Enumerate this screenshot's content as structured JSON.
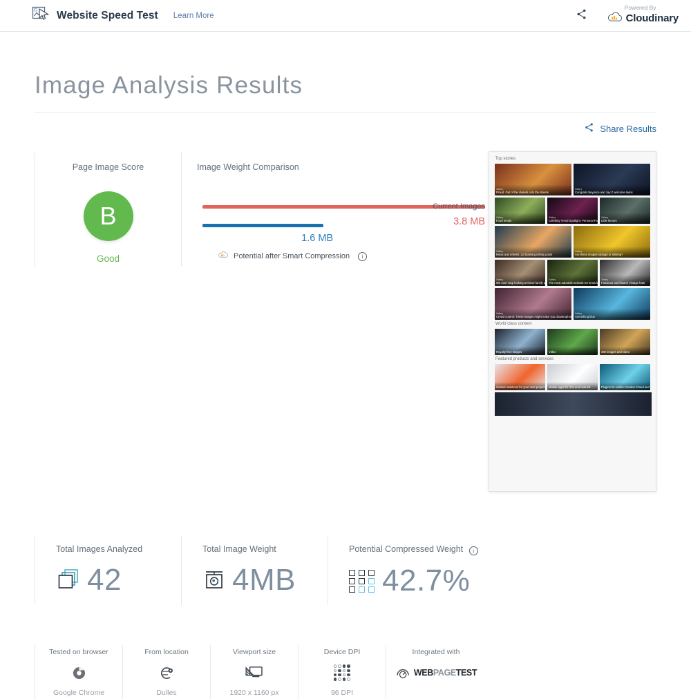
{
  "header": {
    "logo_icon": "image-cursor-icon",
    "title": "Website Speed Test",
    "learn_more": "Learn More",
    "share_icon": "share-icon",
    "powered_by": "Powered By",
    "brand": "Cloudinary"
  },
  "page": {
    "title": "Image Analysis Results",
    "share_results": "Share Results",
    "share_icon": "share-icon"
  },
  "score_card": {
    "label": "Page Image Score",
    "grade": "B",
    "rating": "Good",
    "color": "#62b94d"
  },
  "weight_card": {
    "label": "Image Weight Comparison",
    "current_name": "Current Images",
    "current_value": "3.8 MB",
    "current_color": "#e0645c",
    "potential_value": "1.6 MB",
    "potential_color": "#2c7fbd",
    "potential_label": "Potential after Smart Compression",
    "cloud_icon": "cloudinary-cloud-icon",
    "info_icon": "info-icon",
    "current_pct": 100,
    "potential_pct": 42.7
  },
  "stats": [
    {
      "label": "Total Images Analyzed",
      "value": "42",
      "icon": "stacked-images-icon",
      "has_info": false
    },
    {
      "label": "Total Image Weight",
      "value": "4MB",
      "icon": "image-weight-icon",
      "has_info": false
    },
    {
      "label": "Potential Compressed Weight",
      "value": "42.7%",
      "icon": "pixel-grid-icon",
      "has_info": true,
      "info_icon": "info-icon"
    }
  ],
  "meta": [
    {
      "label": "Tested on browser",
      "value": "Google Chrome",
      "icon": "chrome-icon"
    },
    {
      "label": "From location",
      "value": "Dulles",
      "icon": "globe-pin-icon"
    },
    {
      "label": "Viewport size",
      "value": "1920 x 1160 px",
      "icon": "monitor-icon"
    },
    {
      "label": "Device DPI",
      "value": "96 DPI",
      "icon": "dpi-dots-icon"
    },
    {
      "label": "Integrated with",
      "value": "",
      "icon": "webpagetest-logo-icon",
      "logo_parts": [
        "WEB",
        "PAGE",
        "TEST"
      ]
    }
  ],
  "screenshot": {
    "sections": [
      {
        "heading": "Top stories",
        "rows": [
          [
            {
              "kicker": "Gallery",
              "caption": "Proud. Out of the closets, into the streets",
              "c1": "#7a2f1d",
              "c2": "#d8913f"
            },
            {
              "kicker": "Gallery",
              "caption": "Congrats! Beyonce and Jay Z welcome twins",
              "c1": "#0e1424",
              "c2": "#2b3a55"
            }
          ],
          [
            {
              "kicker": "Gallery",
              "caption": "Food trends",
              "c1": "#2d4a22",
              "c2": "#8fae5b"
            },
            {
              "kicker": "Gallery",
              "caption": "Celebrity Trend Spotlight: Personal Fashion Statements",
              "c1": "#140812",
              "c2": "#6d2250"
            },
            {
              "kicker": "Gallery",
              "caption": "Little lemurs",
              "c1": "#1c2a2a",
              "c2": "#5c6f68"
            }
          ],
          [
            {
              "kicker": "Gallery",
              "caption": "Relax and refresh: 12 stunning infinity pools",
              "c1": "#1d3b4f",
              "c2": "#e8a765"
            },
            {
              "kicker": "Gallery",
              "caption": "Are these images strange or striking?",
              "c1": "#8a6a10",
              "c2": "#f0c62a"
            }
          ],
          [
            {
              "kicker": "Gallery",
              "caption": "We can't stop looking at these family portraits",
              "c1": "#3a2a22",
              "c2": "#a58f74"
            },
            {
              "kicker": "Gallery",
              "caption": "The most adorable animals we know last week",
              "c1": "#18240f",
              "c2": "#5e7238"
            },
            {
              "kicker": "Gallery",
              "caption": "Fabulous and bizarre vintage hats",
              "c1": "#2a2a2a",
              "c2": "#b9b9b9"
            }
          ],
          [
            {
              "kicker": "Gallery",
              "caption": "Crowd control: These images might make you claustrophobic",
              "c1": "#402230",
              "c2": "#b07a8e"
            },
            {
              "kicker": "Gallery",
              "caption": "Something blue",
              "c1": "#0e3a5c",
              "c2": "#58b6dd"
            }
          ]
        ]
      },
      {
        "heading": "World class content",
        "rows": [
          [
            {
              "kicker": "",
              "caption": "Royalty-free images",
              "c1": "#1b2430",
              "c2": "#8fb2cf"
            },
            {
              "kicker": "",
              "caption": "Video",
              "c1": "#1d3a1e",
              "c2": "#5fa84a"
            },
            {
              "kicker": "",
              "caption": "360 images and video",
              "c1": "#4a3a26",
              "c2": "#d1a558"
            }
          ]
        ]
      },
      {
        "heading": "Featured products and services",
        "rows": [
          [
            {
              "kicker": "",
              "caption": "Custom solutions for your next project",
              "c1": "#e9e4ea",
              "c2": "#f0642c"
            },
            {
              "kicker": "",
              "caption": "Mobile apps for iOS and Android",
              "c1": "#c9ccd2",
              "c2": "#ffffff"
            },
            {
              "kicker": "",
              "caption": "Plugins for Adobe Creative Cloud and more",
              "c1": "#0c5a78",
              "c2": "#6fd1e8"
            }
          ]
        ]
      }
    ],
    "footer_strip": {
      "c1": "#1b2230",
      "c2": "#3e4a5c"
    }
  }
}
